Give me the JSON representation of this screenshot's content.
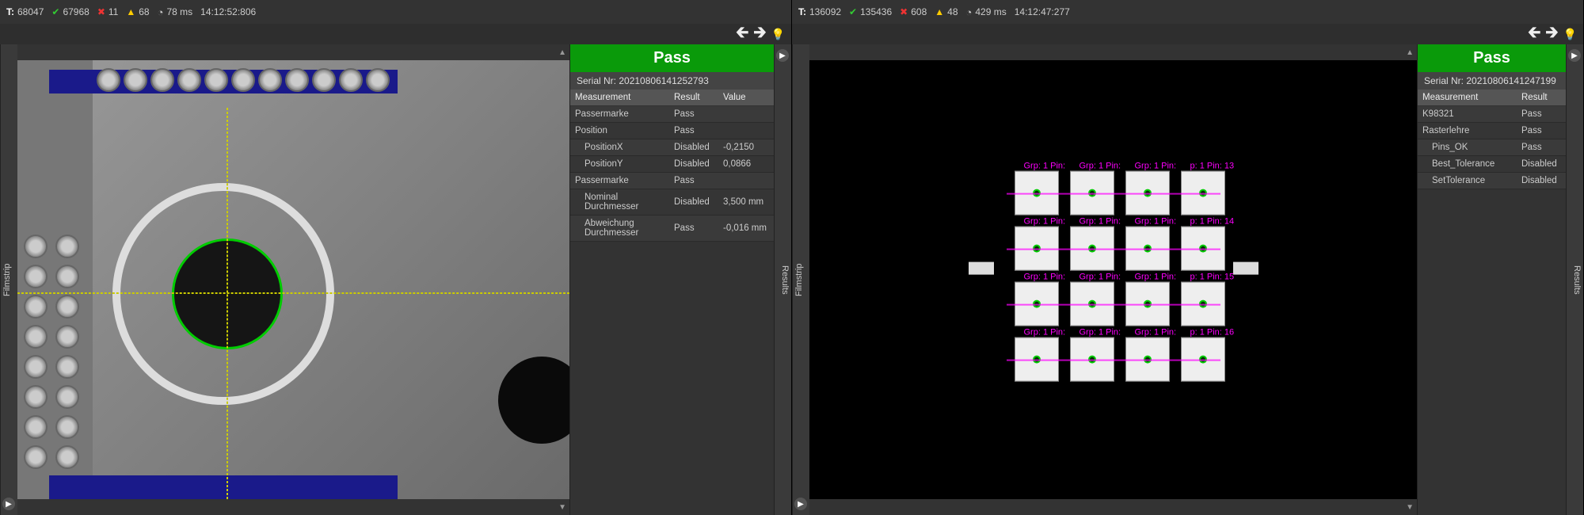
{
  "panes": [
    {
      "stats": {
        "t_label": "T:",
        "t": "68047",
        "pass": "67968",
        "fail": "11",
        "warn": "68",
        "ms": "78 ms",
        "time": "14:12:52:806"
      },
      "filmstrip_label": "Filmstrip",
      "results_label": "Results",
      "pass_label": "Pass",
      "serial_prefix": "Serial Nr:",
      "serial": "20210806141252793",
      "headers": {
        "measurement": "Measurement",
        "result": "Result",
        "value": "Value"
      },
      "rows": [
        {
          "m": "Passermarke",
          "r": "Pass",
          "v": "",
          "indent": 0
        },
        {
          "m": "Position",
          "r": "Pass",
          "v": "",
          "indent": 0
        },
        {
          "m": "PositionX",
          "r": "Disabled",
          "v": "-0,2150",
          "indent": 1
        },
        {
          "m": "PositionY",
          "r": "Disabled",
          "v": "0,0866",
          "indent": 1
        },
        {
          "m": "Passermarke",
          "r": "Pass",
          "v": "",
          "indent": 0
        },
        {
          "m": "Nominal Durchmesser",
          "r": "Disabled",
          "v": "3,500 mm",
          "indent": 1
        },
        {
          "m": "Abweichung Durchmesser",
          "r": "Pass",
          "v": "-0,016 mm",
          "indent": 1
        }
      ]
    },
    {
      "stats": {
        "t_label": "T:",
        "t": "136092",
        "pass": "135436",
        "fail": "608",
        "warn": "48",
        "ms": "429 ms",
        "time": "14:12:47:277"
      },
      "filmstrip_label": "Filmstrip",
      "results_label": "Results",
      "pass_label": "Pass",
      "serial_prefix": "Serial Nr:",
      "serial": "20210806141247199",
      "headers": {
        "measurement": "Measurement",
        "result": "Result"
      },
      "rows": [
        {
          "m": "K98321",
          "r": "Pass",
          "indent": 0
        },
        {
          "m": "Rasterlehre",
          "r": "Pass",
          "indent": 0
        },
        {
          "m": "Pins_OK",
          "r": "Pass",
          "indent": 1
        },
        {
          "m": "Best_Tolerance",
          "r": "Disabled",
          "indent": 1
        },
        {
          "m": "SetTolerance",
          "r": "Disabled",
          "indent": 1
        }
      ],
      "pin_labels": [
        "Grp: 1 Pin:",
        "Grp: 1 Pin:",
        "Grp: 1 Pin:",
        "p: 1 Pin: 13",
        "Grp: 1 Pin:",
        "Grp: 1 Pin:",
        "Grp: 1 Pin:",
        "p: 1 Pin: 14",
        "Grp: 1 Pin:",
        "Grp: 1 Pin:",
        "Grp: 1 Pin:",
        "p: 1 Pin: 15",
        "Grp: 1 Pin:",
        "Grp: 1 Pin:",
        "Grp: 1 Pin:",
        "p: 1 Pin: 16"
      ]
    }
  ]
}
